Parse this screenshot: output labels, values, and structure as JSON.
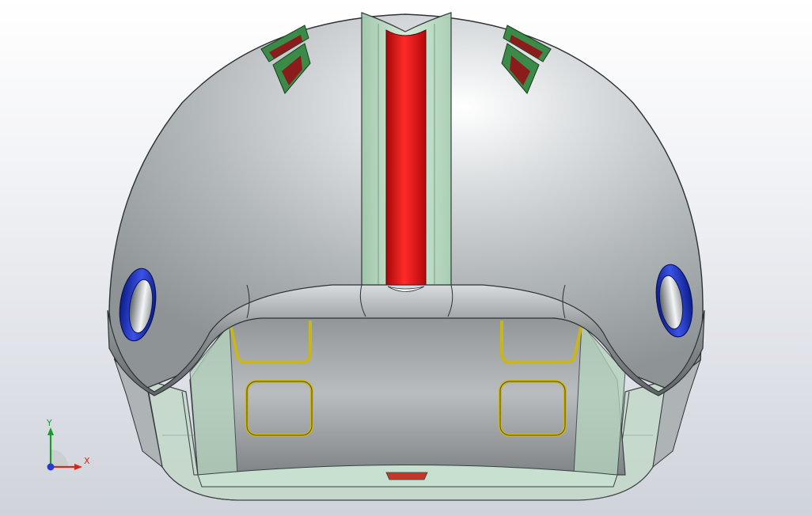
{
  "viewport": {
    "background_top": "#ffffff",
    "background_bottom": "#cfd3da"
  },
  "model": {
    "shell_color": "#bfc4c6",
    "stripe_color": "#e01212",
    "transparent_green": "#b9dcc4",
    "vent_color": "#8c1b1b",
    "ear_hole_color": "#1a2fb0",
    "grill_color": "#c9b51c"
  },
  "triad": {
    "x_label": "X",
    "y_label": "Y",
    "x_color": "#d8261c",
    "y_color": "#1a9a2a",
    "z_color": "#2a3ad0"
  }
}
